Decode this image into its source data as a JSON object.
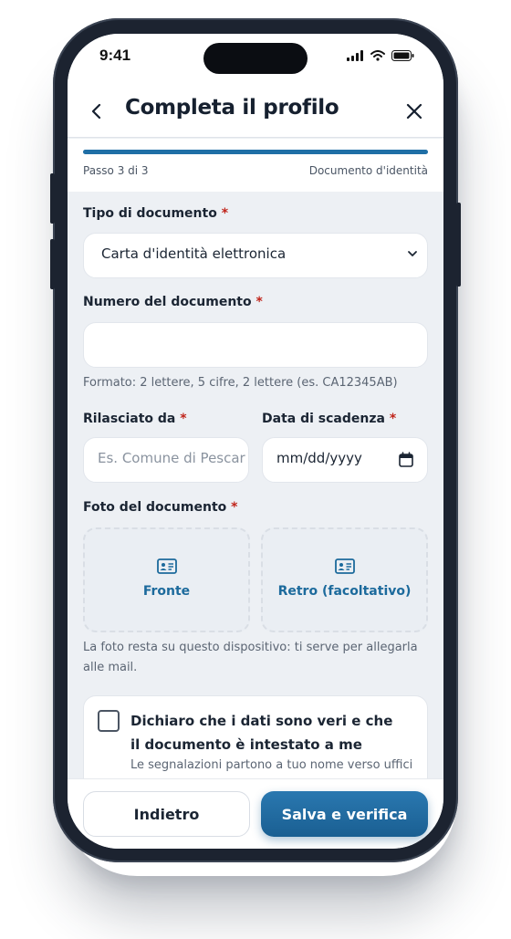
{
  "status_bar": {
    "time": "9:41"
  },
  "header": {
    "title": "Completa il profilo",
    "back_icon": "chevron-left-icon",
    "close_icon": "close-icon"
  },
  "progress": {
    "value": 1.0,
    "step_label": "Passo 3 di 3",
    "step_name": "Documento d'identità",
    "color": "#1f6fa6"
  },
  "form": {
    "document_type": {
      "label": "Tipo di documento",
      "required": "*",
      "value": "Carta d'identità elettronica"
    },
    "document_number": {
      "label": "Numero del documento",
      "required": "*",
      "value": "",
      "hint": "Formato: 2 lettere, 5 cifre, 2 lettere (es. CA12345AB)"
    },
    "issued_by": {
      "label": "Rilasciato da",
      "required": "*",
      "placeholder": "Es. Comune di Pescar"
    },
    "expiry_date": {
      "label": "Data di scadenza",
      "required": "*",
      "placeholder": "mm/dd/yyyy"
    },
    "photo": {
      "label": "Foto del documento",
      "required": "*",
      "front_label": "Fronte",
      "back_label": "Retro (facoltativo)",
      "hint": "La foto resta su questo dispositivo: ti serve per allegarla alle mail."
    },
    "consent": {
      "checked": false,
      "title": "Dichiaro che i dati sono veri e che il documento è intestato a me",
      "subtitle": "Le segnalazioni partono a tuo nome verso uffici"
    }
  },
  "actions": {
    "back_label": "Indietro",
    "save_label": "Salva e verifica"
  },
  "colors": {
    "accent": "#1f6fa6",
    "required": "#c0241a",
    "background": "#edf0f4"
  }
}
